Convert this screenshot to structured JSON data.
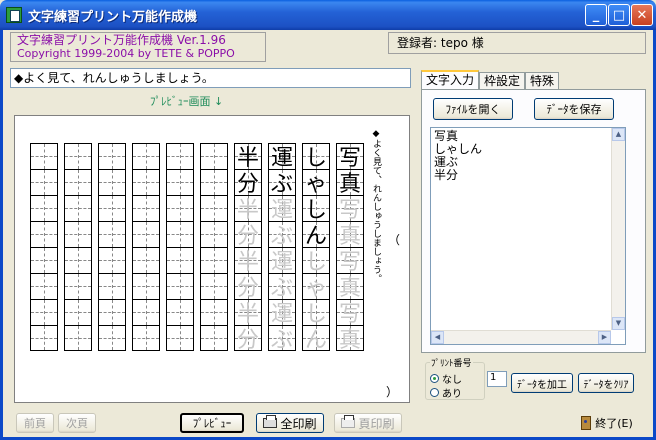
{
  "window": {
    "title": "文字練習プリント万能作成機",
    "min_glyph": "_",
    "max_glyph": "□",
    "close_glyph": "✕"
  },
  "header": {
    "app_line1": "文字練習プリント万能作成機 Ver.1.96",
    "app_line2": "Copyright 1999-2004 by TETE & POPPO",
    "registrant": "登録者: tepo 様"
  },
  "message": {
    "value": "◆よく見て、れんしゅうしましょう。"
  },
  "preview": {
    "label": "ﾌﾟﾚﾋﾞｭｰ画面 ↓",
    "note": "◆よく見て、れんしゅうしましょう。",
    "paren_open": "（",
    "paren_close": "）",
    "columns": [
      {
        "chars": [
          "写",
          "真",
          "写",
          "真",
          "写",
          "真",
          "写",
          "真"
        ],
        "solid": 2
      },
      {
        "chars": [
          "し",
          "ゃ",
          "し",
          "ん",
          "し",
          "ゃ",
          "し",
          "ん"
        ],
        "solid": 4
      },
      {
        "chars": [
          "運",
          "ぶ",
          "運",
          "ぶ",
          "運",
          "ぶ",
          "運",
          "ぶ"
        ],
        "solid": 2
      },
      {
        "chars": [
          "半",
          "分",
          "半",
          "分",
          "半",
          "分",
          "半",
          "分"
        ],
        "solid": 2
      },
      {
        "chars": [
          "",
          "",
          "",
          "",
          "",
          "",
          "",
          ""
        ],
        "solid": 0
      },
      {
        "chars": [
          "",
          "",
          "",
          "",
          "",
          "",
          "",
          ""
        ],
        "solid": 0
      },
      {
        "chars": [
          "",
          "",
          "",
          "",
          "",
          "",
          "",
          ""
        ],
        "solid": 0
      },
      {
        "chars": [
          "",
          "",
          "",
          "",
          "",
          "",
          "",
          ""
        ],
        "solid": 0
      },
      {
        "chars": [
          "",
          "",
          "",
          "",
          "",
          "",
          "",
          ""
        ],
        "solid": 0
      },
      {
        "chars": [
          "",
          "",
          "",
          "",
          "",
          "",
          "",
          ""
        ],
        "solid": 0
      }
    ]
  },
  "tabs": [
    {
      "label": "文字入力",
      "active": true
    },
    {
      "label": "枠設定",
      "active": false
    },
    {
      "label": "特殊",
      "active": false
    }
  ],
  "input_tab": {
    "open_file_label": "ﾌｧｲﾙを開く",
    "save_data_label": "ﾃﾞｰﾀを保存",
    "words": [
      "写真",
      "しゃしん",
      "運ぶ",
      "半分"
    ]
  },
  "print_number": {
    "legend": "ﾌﾟﾘﾝﾄ番号",
    "option_none": "なし",
    "option_yes": "あり",
    "selected": "なし",
    "value": "1"
  },
  "actions": {
    "process_label": "ﾃﾞｰﾀを加工",
    "clear_label": "ﾃﾞｰﾀをｸﾘｱ",
    "prev_page_label": "前頁",
    "next_page_label": "次頁",
    "preview_label": "ﾌﾟﾚﾋﾞｭｰ",
    "print_all_label": "全印刷",
    "print_page_label": "頁印刷",
    "exit_label": "終了(E)"
  }
}
